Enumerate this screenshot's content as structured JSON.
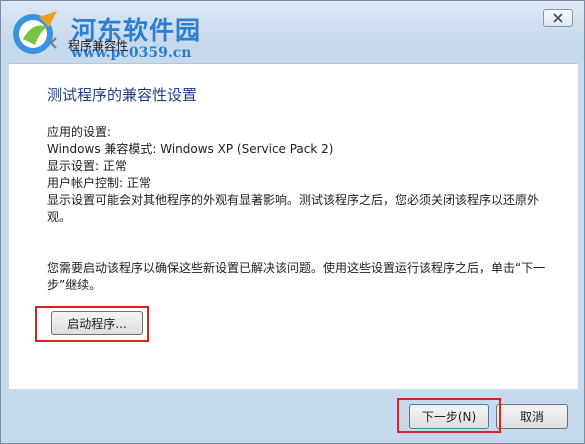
{
  "watermark": {
    "site_name": "河东软件园",
    "url": "www.pc0359.cn"
  },
  "window": {
    "title": "程序兼容性"
  },
  "main": {
    "heading": "测试程序的兼容性设置",
    "applied_label": "应用的设置:",
    "compat_mode": "Windows 兼容模式: Windows XP (Service Pack 2)",
    "display_setting": "显示设置: 正常",
    "uac": "用户帐户控制: 正常",
    "display_note": "显示设置可能会对其他程序的外观有显著影响。测试该程序之后，您必须关闭该程序以还原外观。",
    "instruction": "您需要启动该程序以确保这些新设置已解决该问题。使用这些设置运行该程序之后，单击“下一步”继续。",
    "start_button": "启动程序..."
  },
  "footer": {
    "next_button": "下一步(N)",
    "cancel_button": "取消"
  },
  "colors": {
    "heading": "#1f3f8c",
    "highlight": "#e0201d",
    "watermark": "#2a7fd3"
  }
}
